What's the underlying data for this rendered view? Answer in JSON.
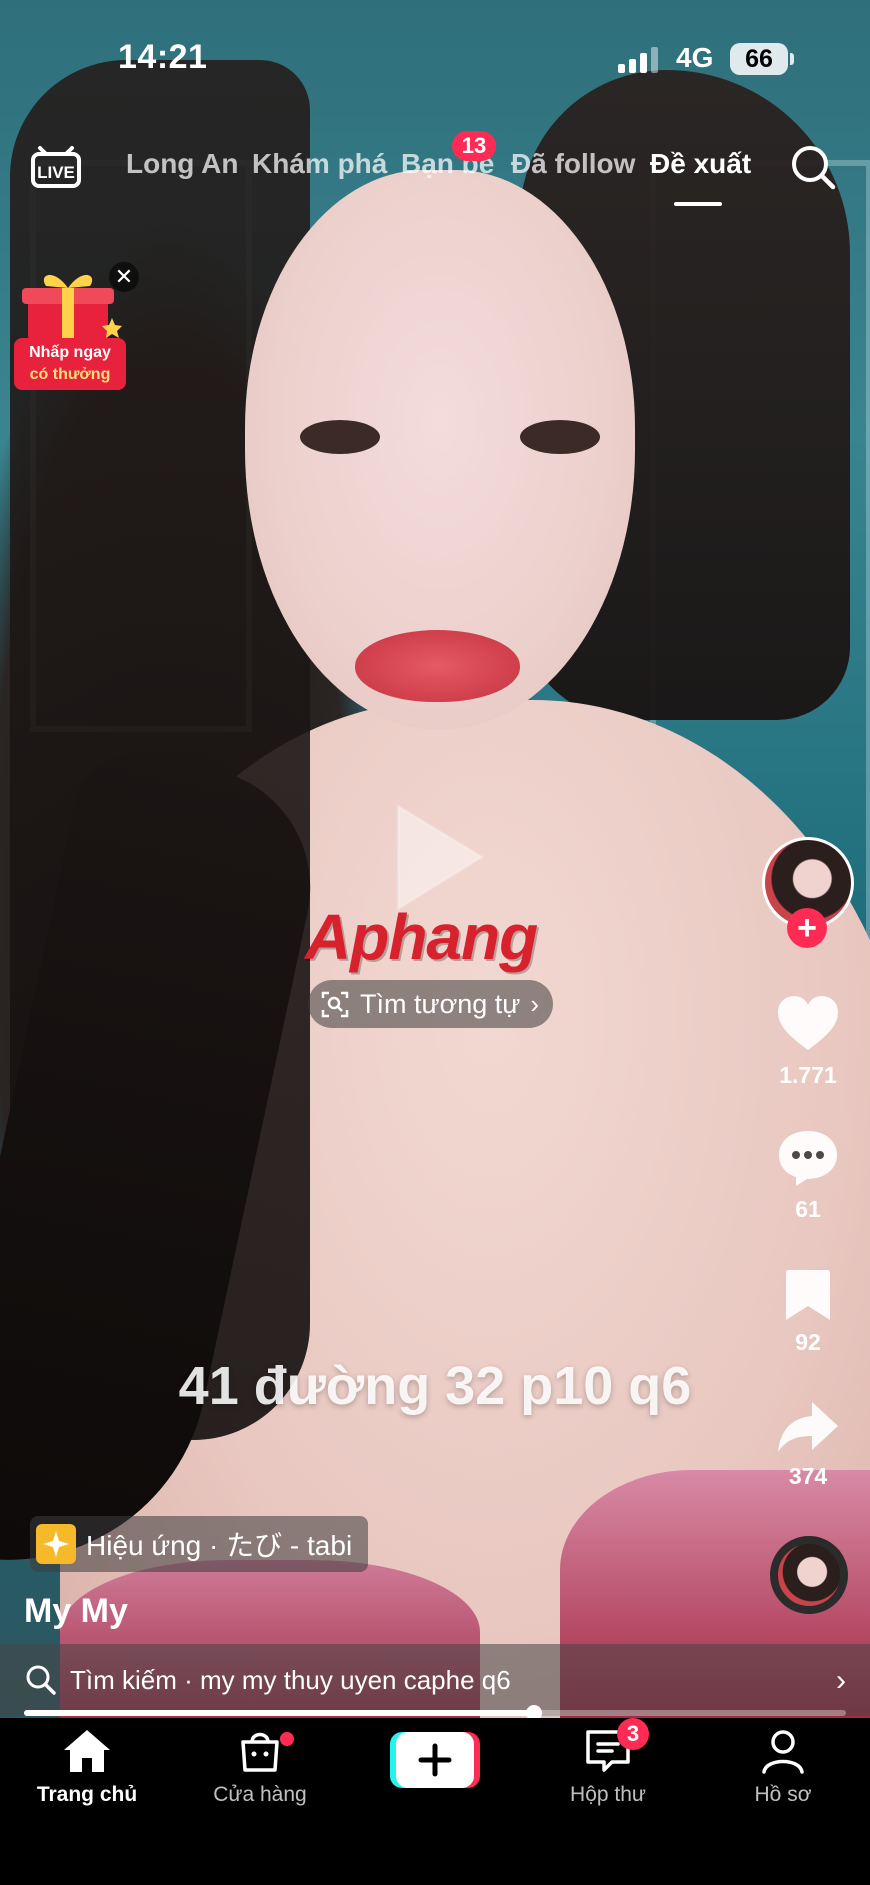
{
  "status_bar": {
    "time": "14:21",
    "network": "4G",
    "battery": "66"
  },
  "top_nav": {
    "live_label": "LIVE",
    "tabs": [
      {
        "label": "Long An"
      },
      {
        "label": "Khám phá"
      },
      {
        "label": "Bạn bè",
        "badge": "13"
      },
      {
        "label": "Đã follow"
      },
      {
        "label": "Đề xuất",
        "active": true
      }
    ]
  },
  "promo": {
    "line1": "Nhấp ngay",
    "line2": "có thưởng"
  },
  "video": {
    "watermark": "Aphang",
    "find_similar": "Tìm tương tự",
    "caption_overlay": "41 đường 32 p10 q6",
    "effect": "Hiệu ứng · たび - tabi",
    "username": "My My"
  },
  "actions": {
    "likes": "1.771",
    "comments": "61",
    "saves": "92",
    "shares": "374"
  },
  "search_suggestion": {
    "text": "Tìm kiếm · my my thuy uyen caphe q6"
  },
  "playback": {
    "progress": 0.62
  },
  "bottom_nav": {
    "home": "Trang chủ",
    "shop": "Cửa hàng",
    "inbox": "Hộp thư",
    "inbox_badge": "3",
    "profile": "Hồ sơ"
  },
  "colors": {
    "accent": "#fe2c55",
    "cyan": "#25f4ee"
  }
}
